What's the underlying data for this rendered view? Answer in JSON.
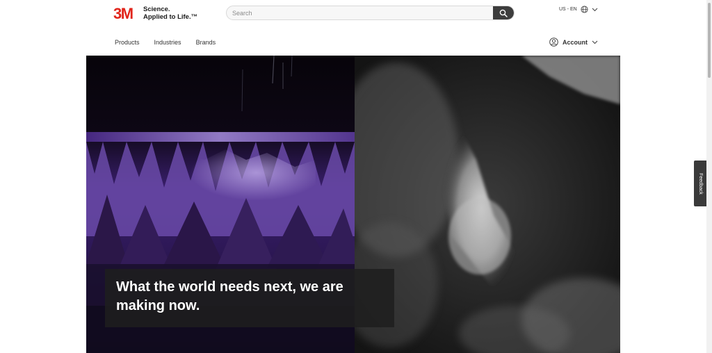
{
  "brand": {
    "logo_text": "3M",
    "tagline_line1": "Science.",
    "tagline_line2": "Applied to Life.™",
    "color": "#e1251b"
  },
  "search": {
    "placeholder": "Search",
    "value": "",
    "icon": "search-icon"
  },
  "locale": {
    "label": "US - EN",
    "icon": "globe-icon"
  },
  "nav": {
    "items": [
      {
        "label": "Products"
      },
      {
        "label": "Industries"
      },
      {
        "label": "Brands"
      }
    ]
  },
  "account": {
    "label": "Account",
    "icon": "user-icon"
  },
  "hero": {
    "headline": "What the world needs next, we are making now."
  },
  "feedback": {
    "label": "Feedback"
  },
  "colors": {
    "accent": "#e1251b",
    "search_button": "#3d3d3d",
    "caption_bg": "#1e1e1e"
  }
}
